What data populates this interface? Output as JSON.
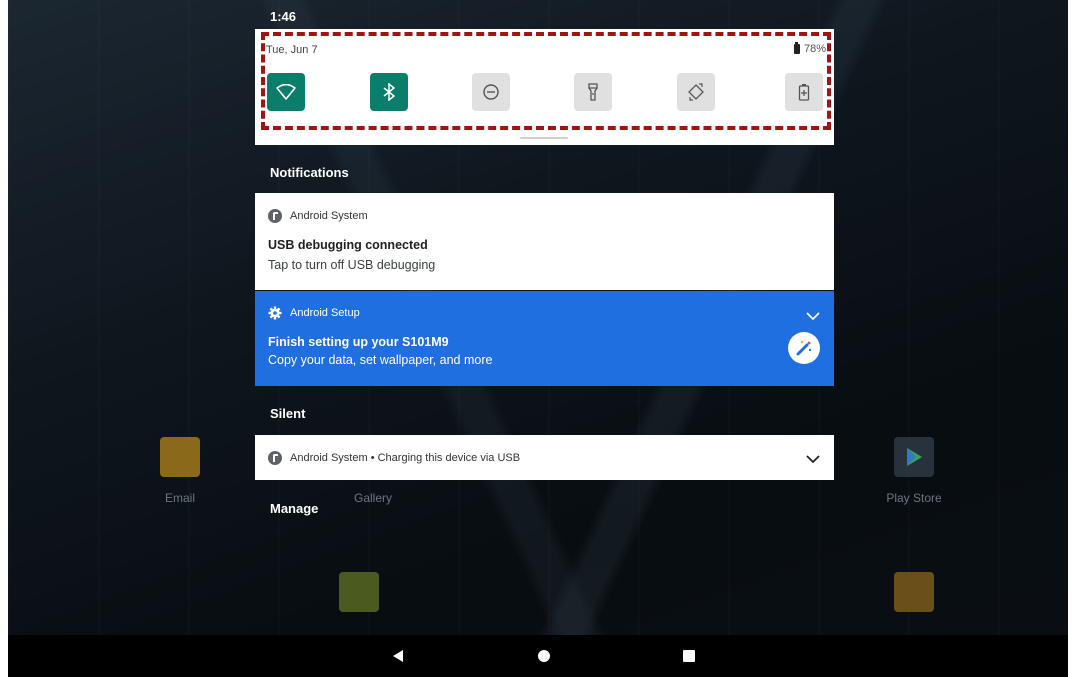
{
  "status_bar": {
    "time": "1:46"
  },
  "quick_settings": {
    "date": "Tue, Jun 7",
    "battery": "78%",
    "tiles": [
      {
        "name": "wifi",
        "icon": "wifi-icon",
        "state": "on"
      },
      {
        "name": "bluetooth",
        "icon": "bluetooth-icon",
        "state": "on"
      },
      {
        "name": "do-not-disturb",
        "icon": "do-not-disturb-icon",
        "state": "off"
      },
      {
        "name": "flashlight",
        "icon": "flashlight-icon",
        "state": "off"
      },
      {
        "name": "auto-rotate",
        "icon": "auto-rotate-icon",
        "state": "off"
      },
      {
        "name": "battery-saver",
        "icon": "battery-saver-icon",
        "state": "off"
      }
    ]
  },
  "sections": {
    "notifications": "Notifications",
    "silent": "Silent",
    "manage": "Manage"
  },
  "notifications": [
    {
      "app": "Android System",
      "title": "USB debugging connected",
      "text": "Tap to turn off USB debugging"
    },
    {
      "app": "Android Setup",
      "title": "Finish setting up your S101M9",
      "text": "Copy your data, set wallpaper, and more",
      "color": "#1f6fe0"
    }
  ],
  "silent_notification": {
    "text": "Android System • Charging this device via USB"
  },
  "launcher": {
    "email": "Email",
    "gallery": "Gallery",
    "play_store": "Play Store"
  },
  "colors": {
    "tile_active": "#0a7d6b",
    "tile_inactive": "#e0e0e0",
    "highlight": "#a01414"
  }
}
